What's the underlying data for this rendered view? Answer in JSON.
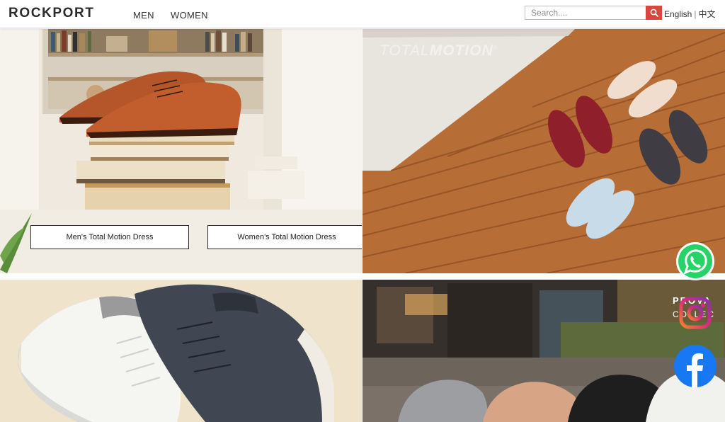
{
  "header": {
    "logo": "ROCKPORT",
    "nav": {
      "men": "MEN",
      "women": "WOMEN"
    },
    "search": {
      "placeholder": "Search...."
    },
    "lang": {
      "english": "English",
      "chinese": "中文"
    }
  },
  "tiles": {
    "tile1": {
      "buttons": {
        "mens": "Men's Total Motion Dress",
        "womens": "Women's Total Motion Dress"
      }
    },
    "tile2": {
      "brand_light": "TOTAL",
      "brand_bold": "MOTION",
      "brand_mark": "®"
    },
    "tile4": {
      "partial_line1": "PROVA",
      "partial_line2": "COLLEC"
    }
  },
  "social": [
    "whatsapp-icon",
    "instagram-icon",
    "facebook-icon"
  ],
  "colors": {
    "search_button": "#d9463e",
    "whatsapp": "#25d366",
    "facebook": "#1877f2"
  }
}
